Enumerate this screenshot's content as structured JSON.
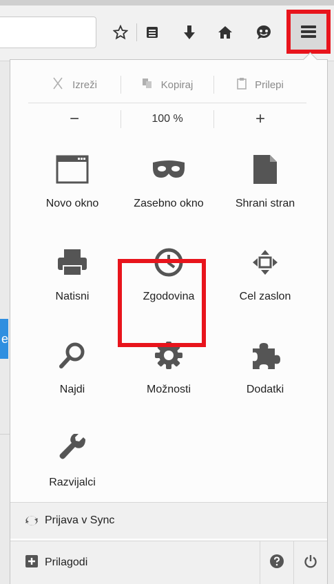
{
  "toolbar": {
    "icons": [
      "star-icon",
      "reading-list-icon",
      "download-icon",
      "home-icon",
      "chat-icon"
    ]
  },
  "sidebar_hint": "e",
  "edit": {
    "cut_label": "Izreži",
    "copy_label": "Kopiraj",
    "paste_label": "Prilepi"
  },
  "zoom": {
    "minus_label": "−",
    "level": "100 %",
    "plus_label": "+"
  },
  "grid": {
    "new_window": "Novo okno",
    "private_window": "Zasebno okno",
    "save_page": "Shrani stran",
    "print": "Natisni",
    "history": "Zgodovina",
    "fullscreen": "Cel zaslon",
    "find": "Najdi",
    "options": "Možnosti",
    "addons": "Dodatki",
    "developer": "Razvijalci"
  },
  "footer": {
    "sync_label": "Prijava v Sync",
    "customize_label": "Prilagodi"
  },
  "colors": {
    "highlight": "#e8141c",
    "icon": "#555555"
  }
}
